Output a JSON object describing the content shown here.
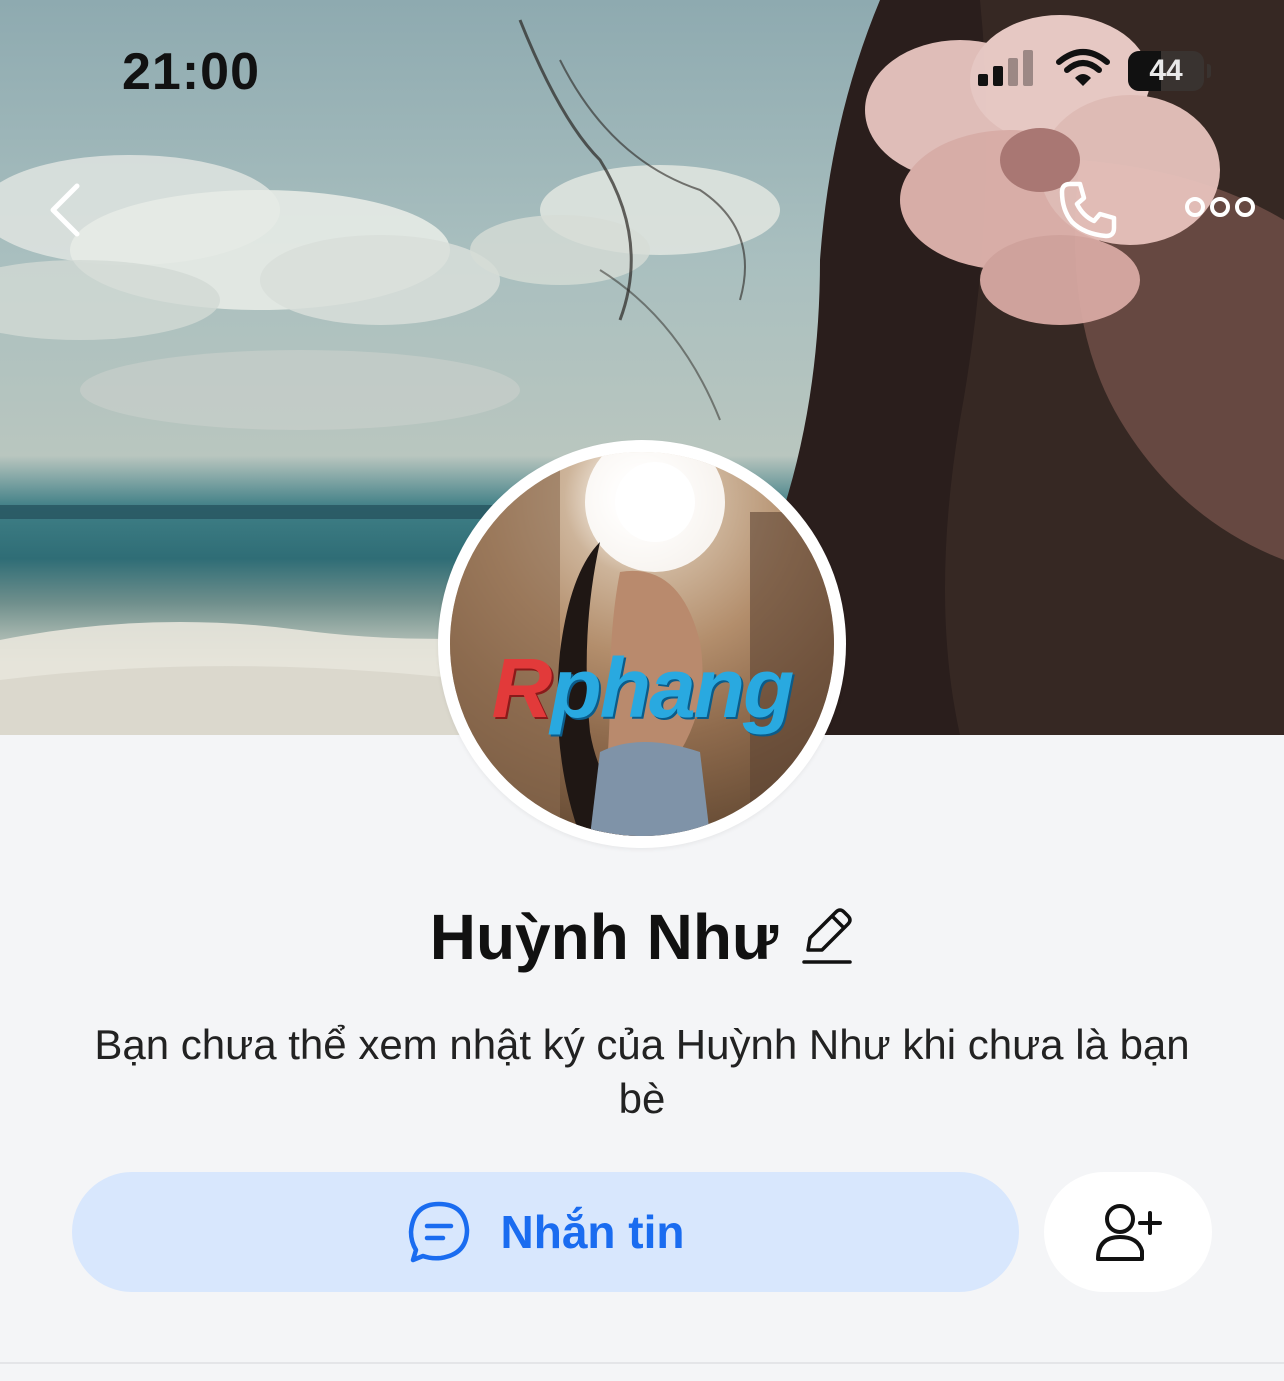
{
  "status_bar": {
    "time": "21:00",
    "battery_level": "44",
    "battery_fraction": 0.44,
    "icons": [
      "cellular-signal-icon",
      "wifi-icon",
      "battery-icon"
    ]
  },
  "header": {
    "icons": [
      "chevron-left-icon",
      "phone-icon",
      "more-options-icon"
    ]
  },
  "profile": {
    "name": "Huỳnh Như",
    "avatar_watermark_r": "R",
    "avatar_watermark_rest": "phang",
    "notice": "Bạn chưa thể xem nhật ký của Huỳnh Như khi chưa là bạn bè"
  },
  "actions": {
    "message_label": "Nhắn tin",
    "message_icon": "chat-bubble-icon",
    "add_friend_icon": "add-user-icon"
  },
  "colors": {
    "accent": "#1a6cf0",
    "message_button_bg": "#d8e7fd",
    "page_bg": "#f4f5f7"
  }
}
